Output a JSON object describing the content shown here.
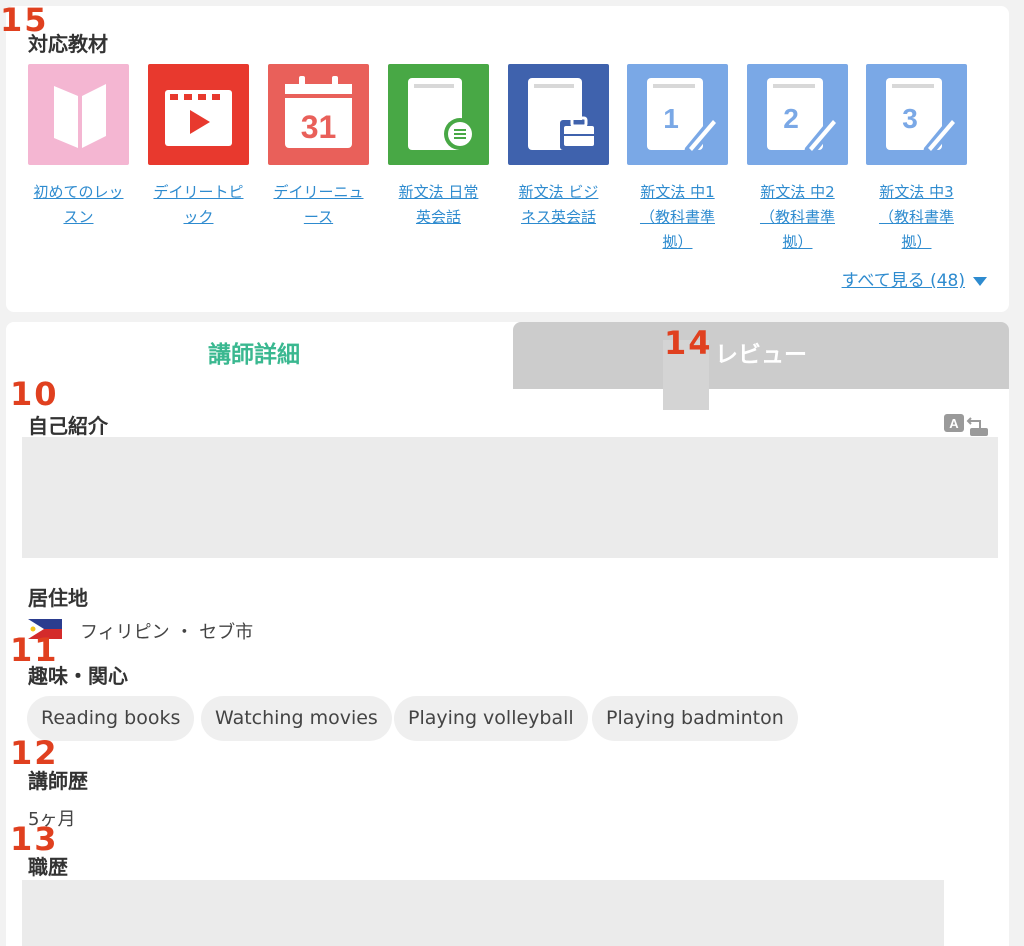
{
  "annotations": {
    "materials": "15",
    "tab_overlay": "14",
    "intro": "10",
    "interests": "11",
    "teaching": "12",
    "career": "13"
  },
  "materials": {
    "title": "対応教材",
    "items": [
      {
        "line1": "初めてのレッ",
        "line2": "スン",
        "line3": "",
        "icon": "open-book-icon",
        "color": "#f4b6d2"
      },
      {
        "line1": "デイリートピ",
        "line2": "ック",
        "line3": "",
        "icon": "video-play-icon",
        "color": "#e8392e"
      },
      {
        "line1": "デイリーニュ",
        "line2": "ース",
        "line3": "",
        "icon": "calendar-31-icon",
        "color": "#e9605a"
      },
      {
        "line1": "新文法 日常",
        "line2": "英会話",
        "line3": "",
        "icon": "chat-book-icon",
        "color": "#48a845"
      },
      {
        "line1": "新文法 ビジ",
        "line2": "ネス英会話",
        "line3": "",
        "icon": "briefcase-book-icon",
        "color": "#3f62ad"
      },
      {
        "line1": "新文法 中1",
        "line2": "（教科書準",
        "line3": "拠）",
        "icon": "pencil-book-1-icon",
        "color": "#7aa8e6"
      },
      {
        "line1": "新文法 中2",
        "line2": "（教科書準",
        "line3": "拠）",
        "icon": "pencil-book-2-icon",
        "color": "#7aa8e6"
      },
      {
        "line1": "新文法 中3",
        "line2": "（教科書準",
        "line3": "拠）",
        "icon": "pencil-book-3-icon",
        "color": "#7aa8e6"
      }
    ],
    "see_all": "すべて見る (48)"
  },
  "tabs": {
    "details": "講師詳細",
    "reviews": "レビュー"
  },
  "profile": {
    "intro_title": "自己紹介",
    "residence_title": "居住地",
    "residence_value": "フィリピン ・ セブ市",
    "interests_title": "趣味・関心",
    "interests": [
      "Reading books",
      "Watching movies",
      "Playing volleyball",
      "Playing badminton"
    ],
    "teaching_title": "講師歴",
    "teaching_value": "5ヶ月",
    "career_title": "職歴"
  },
  "colors": {
    "accent_green": "#3ab890",
    "link_blue": "#2e8bcf",
    "annotation_red": "#e0401f"
  }
}
